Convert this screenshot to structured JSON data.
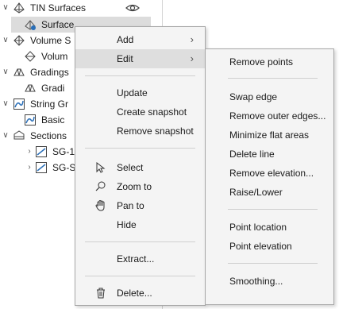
{
  "tree": {
    "items": [
      {
        "label": "TIN Surfaces"
      },
      {
        "label": "Surface"
      },
      {
        "label": "Volume S"
      },
      {
        "label": "Volum"
      },
      {
        "label": "Gradings"
      },
      {
        "label": "Gradi"
      },
      {
        "label": "String Gr"
      },
      {
        "label": "Basic"
      },
      {
        "label": "Sections"
      },
      {
        "label": "SG-1"
      },
      {
        "label": "SG-S"
      }
    ]
  },
  "context_menu": {
    "add": "Add",
    "edit": "Edit",
    "update": "Update",
    "create_snapshot": "Create snapshot",
    "remove_snapshot": "Remove snapshot",
    "select": "Select",
    "zoom_to": "Zoom to",
    "pan_to": "Pan to",
    "hide": "Hide",
    "extract": "Extract...",
    "delete": "Delete...",
    "arrow": "›"
  },
  "edit_submenu": {
    "remove_points": "Remove points",
    "swap_edge": "Swap edge",
    "remove_outer_edges": "Remove outer edges...",
    "minimize_flat_areas": "Minimize flat areas",
    "delete_line": "Delete line",
    "remove_elevation": "Remove elevation...",
    "raise_lower": "Raise/Lower",
    "point_location": "Point location",
    "point_elevation": "Point elevation",
    "smoothing": "Smoothing..."
  },
  "colors": {
    "menu_bg": "#f4f4f4",
    "highlight": "#dedede",
    "icon_blue": "#2a6fb8"
  }
}
